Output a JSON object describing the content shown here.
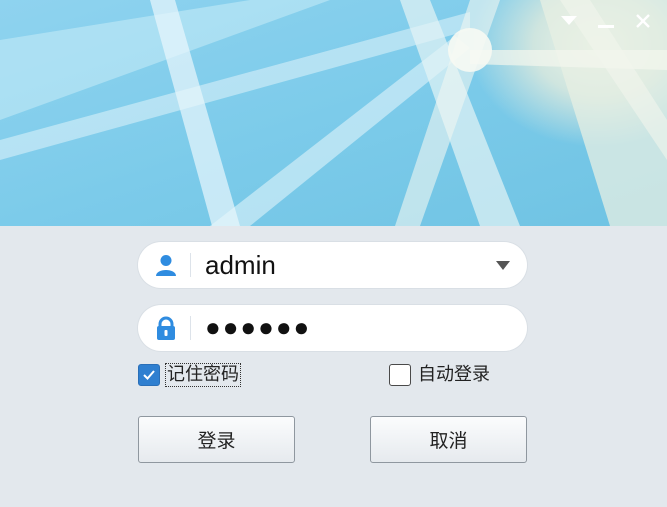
{
  "window": {
    "controls": [
      "menu-arrow-icon",
      "minimize-icon",
      "close-icon"
    ]
  },
  "login": {
    "username": "admin",
    "password_mask": "●●●●●●",
    "remember_password": {
      "label": "记住密码",
      "checked": true
    },
    "auto_login": {
      "label": "自动登录",
      "checked": false
    },
    "login_button": "登录",
    "cancel_button": "取消"
  },
  "colors": {
    "banner_sky": "#7dcdec",
    "icon_blue": "#2f8ce0",
    "checkbox_blue": "#2f7fd0",
    "form_background": "#e3e8ed"
  }
}
